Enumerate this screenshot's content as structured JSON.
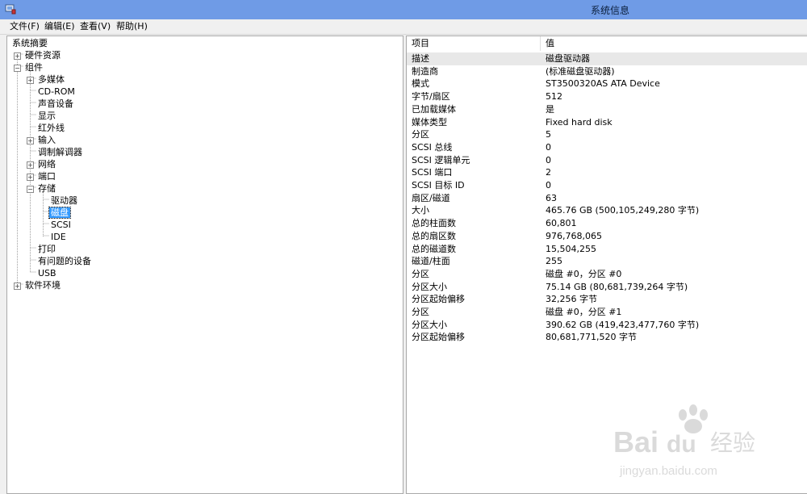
{
  "window": {
    "title": "系统信息",
    "app_icon": "system-info-icon"
  },
  "menu": [
    "文件(F)",
    "编辑(E)",
    "查看(V)",
    "帮助(H)"
  ],
  "tree": {
    "root": "系统摘要",
    "items": [
      {
        "label": "硬件资源",
        "level": 1,
        "expander": "+"
      },
      {
        "label": "组件",
        "level": 1,
        "expander": "-"
      },
      {
        "label": "多媒体",
        "level": 2,
        "expander": "+"
      },
      {
        "label": "CD-ROM",
        "level": 2,
        "expander": ""
      },
      {
        "label": "声音设备",
        "level": 2,
        "expander": ""
      },
      {
        "label": "显示",
        "level": 2,
        "expander": ""
      },
      {
        "label": "红外线",
        "level": 2,
        "expander": ""
      },
      {
        "label": "输入",
        "level": 2,
        "expander": "+"
      },
      {
        "label": "调制解调器",
        "level": 2,
        "expander": ""
      },
      {
        "label": "网络",
        "level": 2,
        "expander": "+"
      },
      {
        "label": "端口",
        "level": 2,
        "expander": "+"
      },
      {
        "label": "存储",
        "level": 2,
        "expander": "-"
      },
      {
        "label": "驱动器",
        "level": 3,
        "expander": ""
      },
      {
        "label": "磁盘",
        "level": 3,
        "expander": "",
        "selected": true
      },
      {
        "label": "SCSI",
        "level": 3,
        "expander": ""
      },
      {
        "label": "IDE",
        "level": 3,
        "expander": ""
      },
      {
        "label": "打印",
        "level": 2,
        "expander": ""
      },
      {
        "label": "有问题的设备",
        "level": 2,
        "expander": ""
      },
      {
        "label": "USB",
        "level": 2,
        "expander": ""
      },
      {
        "label": "软件环境",
        "level": 1,
        "expander": "+"
      }
    ]
  },
  "table": {
    "headers": [
      "项目",
      "值"
    ],
    "rows": [
      [
        "描述",
        "磁盘驱动器"
      ],
      [
        "制造商",
        "(标准磁盘驱动器)"
      ],
      [
        "模式",
        "ST3500320AS ATA Device"
      ],
      [
        "字节/扇区",
        "512"
      ],
      [
        "已加载媒体",
        "是"
      ],
      [
        "媒体类型",
        "Fixed hard disk"
      ],
      [
        "分区",
        "5"
      ],
      [
        "SCSI 总线",
        "0"
      ],
      [
        "SCSI 逻辑单元",
        "0"
      ],
      [
        "SCSI 端口",
        "2"
      ],
      [
        "SCSI 目标 ID",
        "0"
      ],
      [
        "扇区/磁道",
        "63"
      ],
      [
        "大小",
        "465.76 GB (500,105,249,280 字节)"
      ],
      [
        "总的柱面数",
        "60,801"
      ],
      [
        "总的扇区数",
        "976,768,065"
      ],
      [
        "总的磁道数",
        "15,504,255"
      ],
      [
        "磁道/柱面",
        "255"
      ],
      [
        "分区",
        "磁盘 #0，分区 #0"
      ],
      [
        "分区大小",
        "75.14 GB (80,681,739,264 字节)"
      ],
      [
        "分区起始偏移",
        "32,256 字节"
      ],
      [
        "分区",
        "磁盘 #0，分区 #1"
      ],
      [
        "分区大小",
        "390.62 GB (419,423,477,760 字节)"
      ],
      [
        "分区起始偏移",
        "80,681,771,520 字节"
      ]
    ],
    "selected_row": 0
  },
  "watermark": {
    "brand": "Bai",
    "brand2": "du",
    "cn": "经验",
    "url": "jingyan.baidu.com"
  }
}
